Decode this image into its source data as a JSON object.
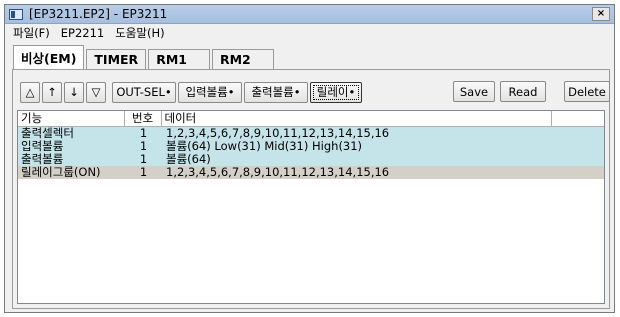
{
  "window": {
    "title": "[EP3211.EP2] - EP3211",
    "close_label": "×"
  },
  "menu": [
    "파일(F)",
    "EP2211",
    "도움말(H)"
  ],
  "tabs": [
    "비상(EM)",
    "TIMER",
    "RM1",
    "RM2"
  ],
  "toolbar": {
    "nav": [
      "△",
      "↑",
      "↓",
      "▽"
    ],
    "modes": [
      "OUT-SEL•",
      "입력볼륨•",
      "출력볼륨•",
      "릴레이•"
    ],
    "save": "Save",
    "read": "Read",
    "delete": "Delete"
  },
  "list": {
    "columns": [
      "기능",
      "번호",
      "데이터",
      ""
    ],
    "rows": [
      {
        "func": "출력셀렉터",
        "num": "1",
        "data": "1,2,3,4,5,6,7,8,9,10,11,12,13,14,15,16"
      },
      {
        "func": "입력볼륨",
        "num": "1",
        "data": "볼륨(64) Low(31) Mid(31) High(31)"
      },
      {
        "func": "출력볼륨",
        "num": "1",
        "data": "볼륨(64)"
      },
      {
        "func": "릴레이그룹(ON)",
        "num": "1",
        "data": "1,2,3,4,5,6,7,8,9,10,11,12,13,14,15,16"
      }
    ]
  }
}
